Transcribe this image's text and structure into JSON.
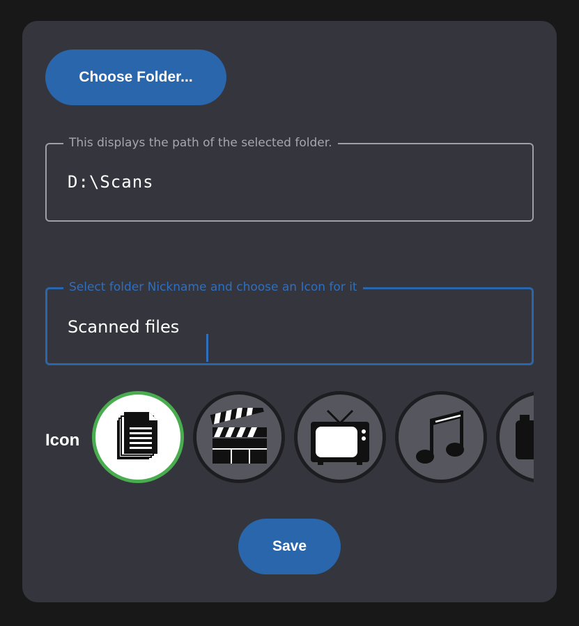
{
  "dialog": {
    "choose_folder_label": "Choose Folder...",
    "path_field": {
      "legend": "This displays the path of the selected folder.",
      "value": "D:\\Scans"
    },
    "nickname_field": {
      "legend": "Select folder Nickname and choose an Icon for it",
      "value": "Scanned files"
    },
    "icon_label": "Icon",
    "icons": [
      {
        "name": "documents-icon",
        "selected": true
      },
      {
        "name": "clapperboard-icon",
        "selected": false
      },
      {
        "name": "television-icon",
        "selected": false
      },
      {
        "name": "music-note-icon",
        "selected": false
      },
      {
        "name": "camera-icon",
        "selected": false
      }
    ],
    "save_label": "Save"
  },
  "colors": {
    "accent": "#2a66ab",
    "selected_ring": "#49ad4f",
    "dialog_bg": "#35353d",
    "page_bg": "#181818"
  }
}
